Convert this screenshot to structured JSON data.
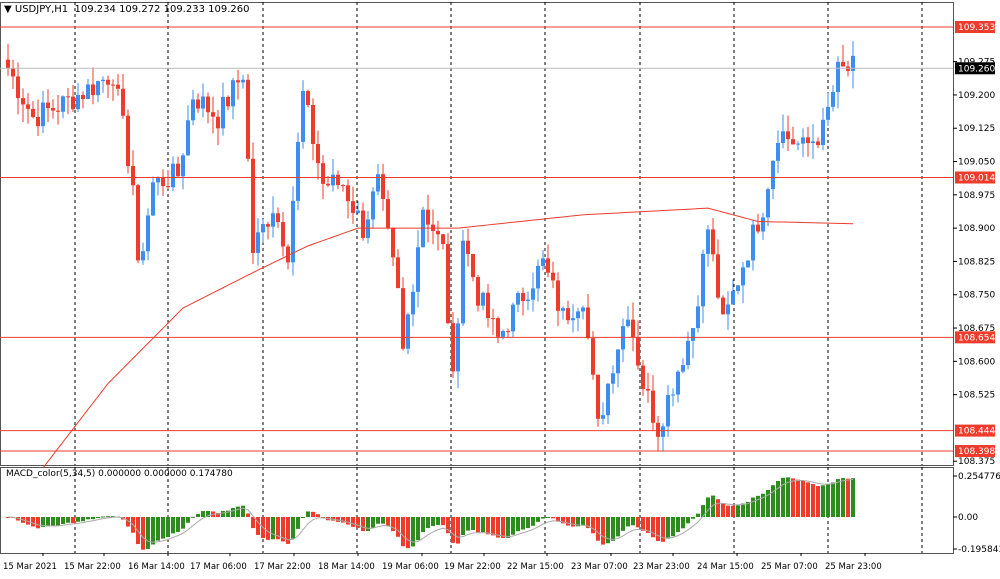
{
  "header": {
    "symbol": "USDJPY,H1",
    "ohlc": "109.234 109.272 109.233 109.260"
  },
  "macd_label": "MACD_color(5,34,5) 0.000000 0.000000 0.174780",
  "colors": {
    "bull": "#3d8ef0",
    "bear": "#ef3b2c",
    "level": "#ef3b2c",
    "ma": "#ef3b2c",
    "macd_up": "#2e8b1e",
    "macd_down": "#ef3b2c",
    "grid": "#000000"
  },
  "chart_data": {
    "type": "candlestick",
    "title": "USDJPY,H1",
    "ylim": [
      108.375,
      109.353
    ],
    "price_ticks": [
      "109.275",
      "109.200",
      "109.125",
      "109.050",
      "108.975",
      "108.900",
      "108.825",
      "108.750",
      "108.675",
      "108.600",
      "108.525",
      "108.375"
    ],
    "levels": [
      "109.353",
      "109.014",
      "108.654",
      "108.444",
      "108.398"
    ],
    "current_price": "109.260",
    "close_waypoints": [
      [
        0,
        109.26
      ],
      [
        5,
        109.15
      ],
      [
        11,
        109.18
      ],
      [
        17,
        109.22
      ],
      [
        21,
        109.25
      ],
      [
        25,
        109.0
      ],
      [
        26,
        108.8
      ],
      [
        29,
        109.0
      ],
      [
        34,
        109.02
      ],
      [
        37,
        109.2
      ],
      [
        42,
        109.15
      ],
      [
        47,
        109.25
      ],
      [
        49,
        108.85
      ],
      [
        53,
        108.95
      ],
      [
        56,
        108.85
      ],
      [
        59,
        109.2
      ],
      [
        63,
        109.0
      ],
      [
        67,
        109.0
      ],
      [
        71,
        108.9
      ],
      [
        74,
        109.0
      ],
      [
        78,
        108.75
      ],
      [
        79,
        108.62
      ],
      [
        83,
        108.95
      ],
      [
        87,
        108.85
      ],
      [
        89,
        108.55
      ],
      [
        91,
        108.88
      ],
      [
        94,
        108.75
      ],
      [
        98,
        108.65
      ],
      [
        103,
        108.75
      ],
      [
        107,
        108.82
      ],
      [
        111,
        108.7
      ],
      [
        115,
        108.75
      ],
      [
        118,
        108.45
      ],
      [
        121,
        108.6
      ],
      [
        124,
        108.72
      ],
      [
        127,
        108.55
      ],
      [
        130,
        108.45
      ],
      [
        133,
        108.55
      ],
      [
        137,
        108.68
      ],
      [
        140,
        108.9
      ],
      [
        143,
        108.68
      ],
      [
        147,
        108.82
      ],
      [
        151,
        108.95
      ],
      [
        154,
        109.12
      ],
      [
        159,
        109.08
      ],
      [
        163,
        109.12
      ],
      [
        166,
        109.25
      ],
      [
        169,
        109.26
      ]
    ],
    "ma_waypoints": [
      [
        7,
        108.36
      ],
      [
        20,
        108.55
      ],
      [
        35,
        108.72
      ],
      [
        49,
        108.8
      ],
      [
        60,
        108.86
      ],
      [
        70,
        108.9
      ],
      [
        90,
        108.9
      ],
      [
        115,
        108.93
      ],
      [
        140,
        108.945
      ],
      [
        150,
        108.915
      ],
      [
        169,
        108.91
      ]
    ],
    "macd": {
      "max": "0.254776",
      "zero": "0.00",
      "min": "-0.195843"
    },
    "time_labels": [
      "15 Mar 2021",
      "15 Mar 22:00",
      "16 Mar 14:00",
      "17 Mar 06:00",
      "17 Mar 22:00",
      "18 Mar 14:00",
      "19 Mar 06:00",
      "19 Mar 22:00",
      "22 Mar 15:00",
      "23 Mar 07:00",
      "23 Mar 23:00",
      "24 Mar 15:00",
      "25 Mar 07:00",
      "25 Mar 23:00"
    ]
  }
}
